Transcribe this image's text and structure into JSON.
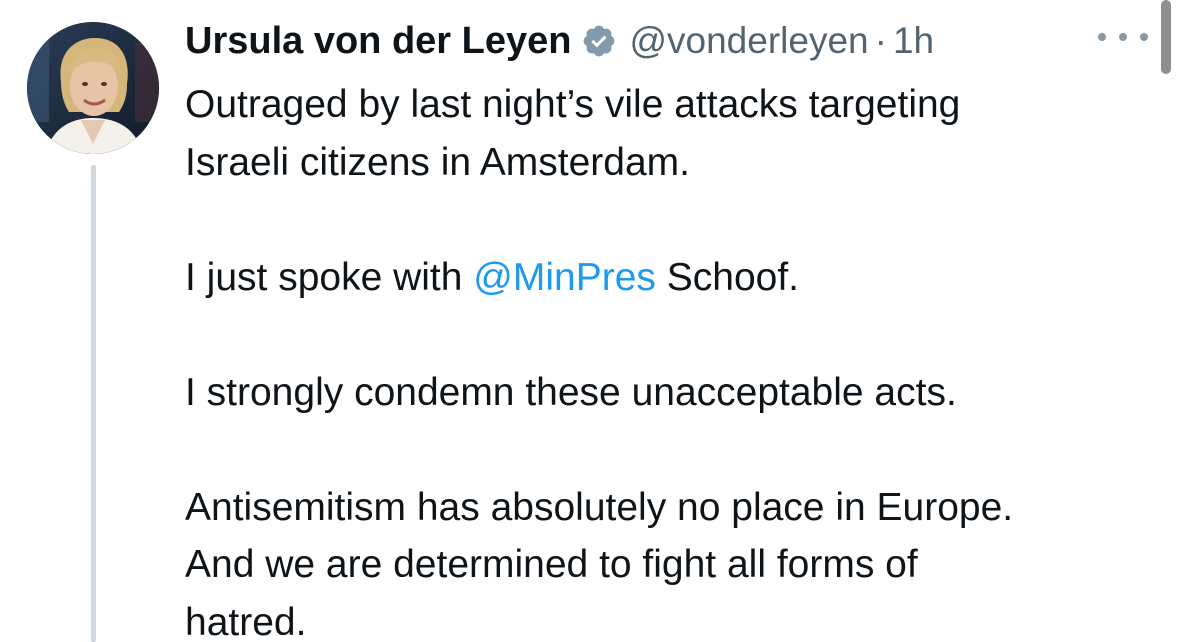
{
  "tweet": {
    "author_name": "Ursula von der Leyen",
    "handle": "@vonderleyen",
    "separator": "·",
    "time": "1h",
    "verified_icon": "verified-badge-icon",
    "more_icon": "more-horizontal-icon",
    "paragraphs": [
      {
        "lines": [
          "Outraged by last night’s vile attacks targeting",
          "Israeli citizens in Amsterdam."
        ]
      },
      {
        "before": "I just spoke with ",
        "mention": "@MinPres",
        "after": " Schoof."
      },
      {
        "lines": [
          "I strongly condemn these unacceptable acts."
        ]
      },
      {
        "lines": [
          "Antisemitism has absolutely no place in Europe.",
          "And we are determined to fight all forms of",
          "hatred."
        ]
      }
    ]
  },
  "colors": {
    "text": "#0f1419",
    "secondary": "#536471",
    "mention": "#1d9bf0",
    "thread_line": "#cfd9de"
  }
}
